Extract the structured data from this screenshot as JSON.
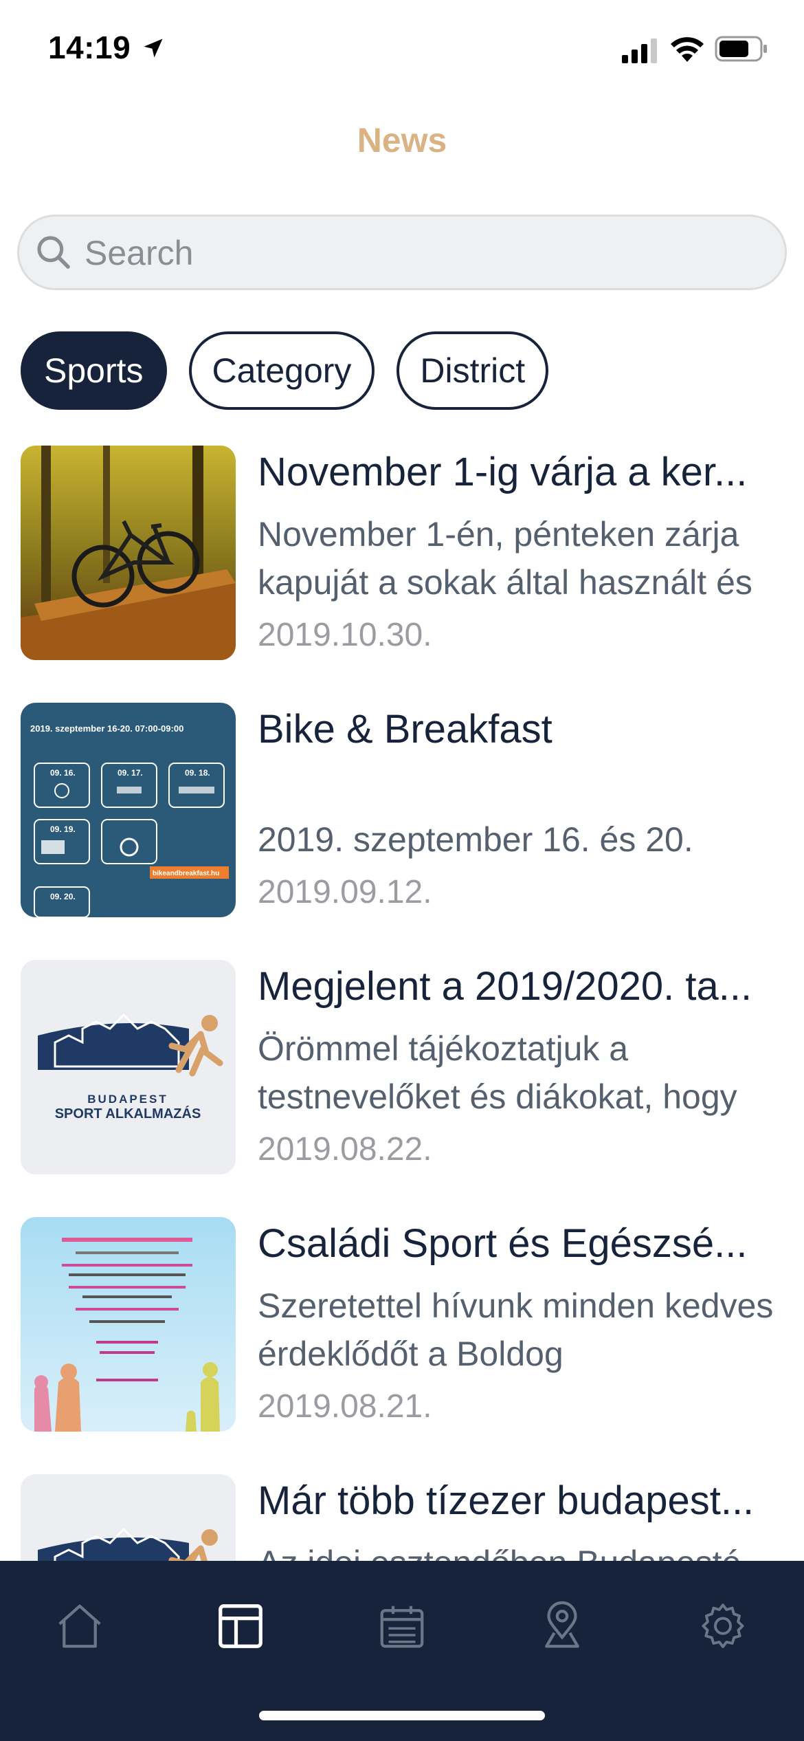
{
  "status_bar": {
    "time": "14:19",
    "icons": [
      "location-arrow-icon",
      "cellular-signal-icon",
      "wifi-icon",
      "battery-icon"
    ]
  },
  "header": {
    "title": "News"
  },
  "search": {
    "placeholder": "Search",
    "value": ""
  },
  "filters": [
    {
      "label": "Sports",
      "active": true
    },
    {
      "label": "Category",
      "active": false
    },
    {
      "label": "District",
      "active": false
    }
  ],
  "news": [
    {
      "title": "November 1-ig várja a ker...",
      "summary": "November 1-én, pénteken zárja kapuját a sokak által használt és",
      "date": "2019.10.30.",
      "thumbnail": "bike-in-forest-photo"
    },
    {
      "title": "Bike & Breakfast",
      "summary": "2019. szeptember 16. és 20.",
      "date": "2019.09.12.",
      "thumbnail": "bike-and-breakfast-poster"
    },
    {
      "title": "Megjelent a 2019/2020. ta...",
      "summary": "Örömmel tájékoztatjuk a testnevelőket és diákokat, hogy",
      "date": "2019.08.22.",
      "thumbnail": "budapest-sport-app-logo"
    },
    {
      "title": "Családi Sport és Egészsé...",
      "summary": "Szeretettel hívunk minden kedves érdeklődőt a Boldog",
      "date": "2019.08.21.",
      "thumbnail": "family-sport-day-poster"
    },
    {
      "title": "Már több tízezer budapest...",
      "summary": "Az idei esztendőben Budapesté",
      "date": "",
      "thumbnail": "budapest-sport-app-logo"
    }
  ],
  "thumb_text": {
    "poster_date": "2019. szeptember 16-20. 07:00-09:00",
    "poster_days": [
      "09. 16.",
      "09. 17.",
      "09. 18.",
      "09. 19.",
      "09. 20."
    ],
    "poster_url": "bikeandbreakfast.hu",
    "logo_line1": "BUDAPEST",
    "logo_line2": "SPORT ALKALMAZÁS"
  },
  "tabbar": {
    "tabs": [
      {
        "icon": "home-icon",
        "active": false
      },
      {
        "icon": "news-layout-icon",
        "active": true
      },
      {
        "icon": "calendar-icon",
        "active": false
      },
      {
        "icon": "map-pin-icon",
        "active": false
      },
      {
        "icon": "settings-gear-icon",
        "active": false
      }
    ]
  },
  "colors": {
    "accent": "#d9b383",
    "navy": "#16233a",
    "text_secondary": "#55606e",
    "date_gray": "#9a9ca2",
    "search_bg": "#eff0f2"
  }
}
